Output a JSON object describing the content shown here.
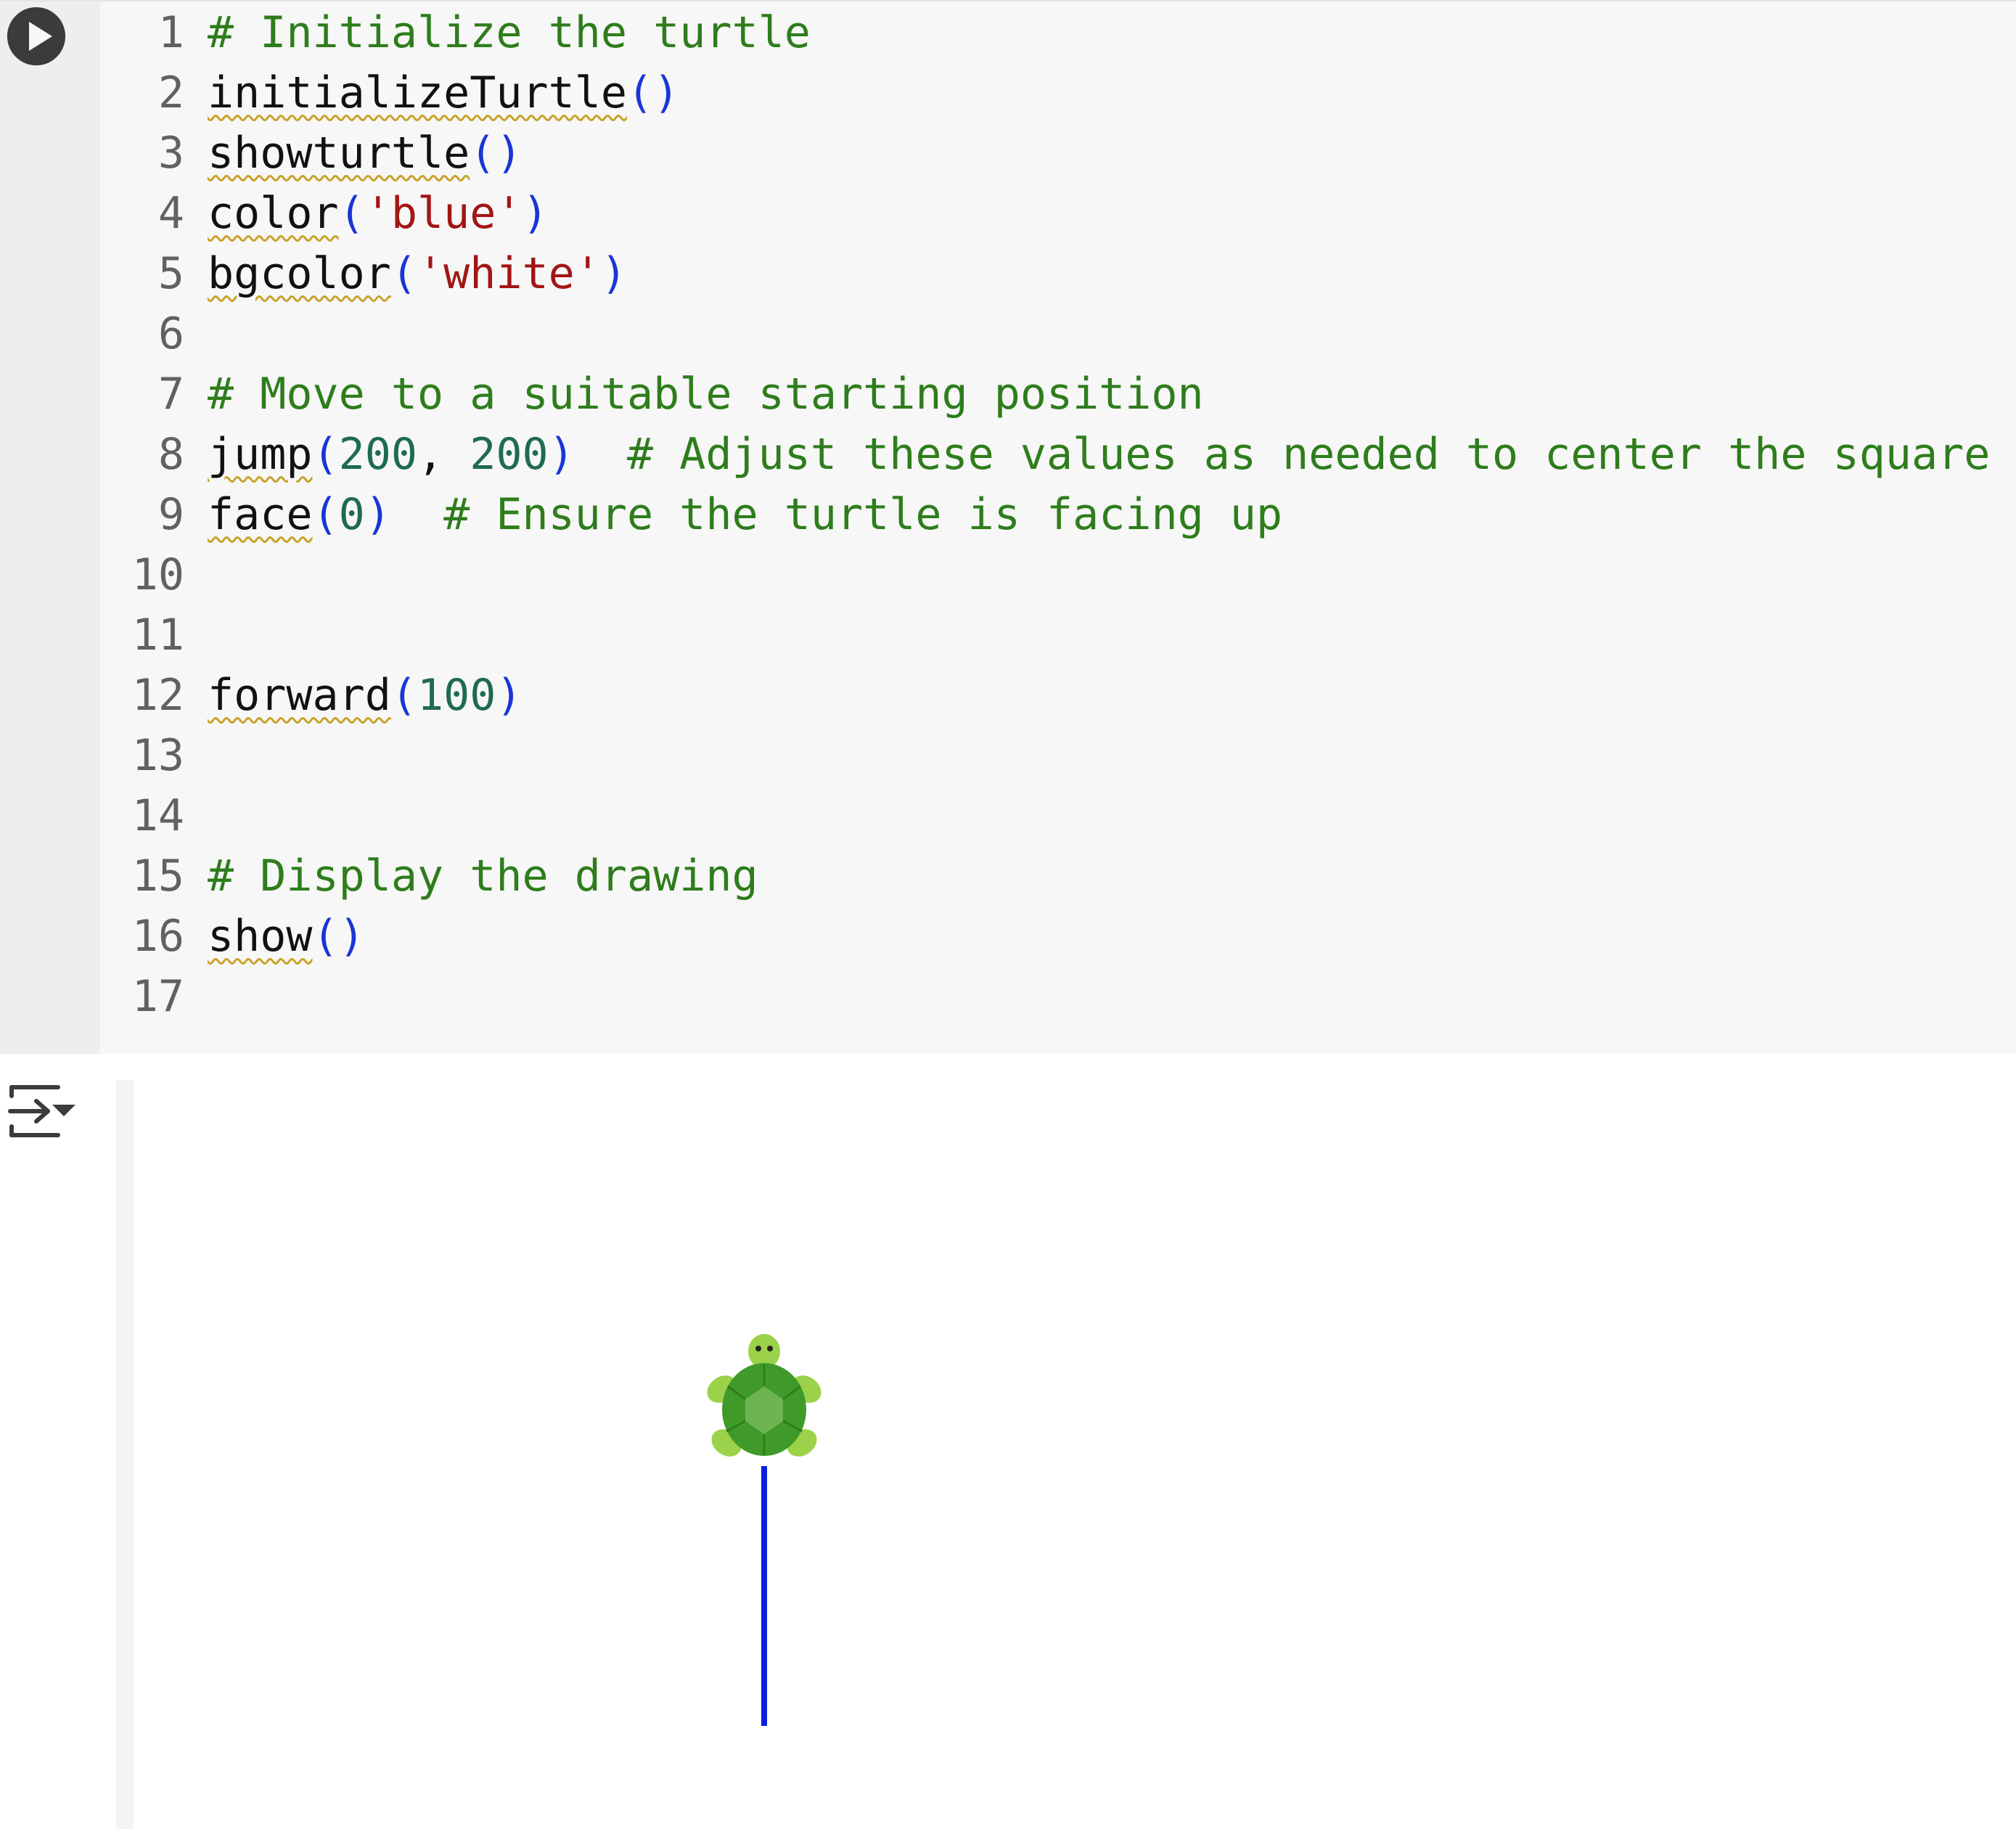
{
  "code_lines": [
    {
      "n": "1",
      "tokens": [
        {
          "t": "# Initialize the turtle",
          "k": "cmt"
        }
      ]
    },
    {
      "n": "2",
      "tokens": [
        {
          "t": "initializeTurtle",
          "k": "fn"
        },
        {
          "t": "()",
          "k": "par"
        }
      ]
    },
    {
      "n": "3",
      "tokens": [
        {
          "t": "showturtle",
          "k": "fn"
        },
        {
          "t": "()",
          "k": "par"
        }
      ]
    },
    {
      "n": "4",
      "tokens": [
        {
          "t": "color",
          "k": "fn"
        },
        {
          "t": "(",
          "k": "par"
        },
        {
          "t": "'blue'",
          "k": "str"
        },
        {
          "t": ")",
          "k": "par"
        }
      ]
    },
    {
      "n": "5",
      "tokens": [
        {
          "t": "bgcolor",
          "k": "fn"
        },
        {
          "t": "(",
          "k": "par"
        },
        {
          "t": "'white'",
          "k": "str"
        },
        {
          "t": ")",
          "k": "par"
        }
      ]
    },
    {
      "n": "6",
      "tokens": []
    },
    {
      "n": "7",
      "tokens": [
        {
          "t": "# Move to a suitable starting position",
          "k": "cmt"
        }
      ]
    },
    {
      "n": "8",
      "tokens": [
        {
          "t": "jump",
          "k": "fn"
        },
        {
          "t": "(",
          "k": "par"
        },
        {
          "t": "200",
          "k": "num"
        },
        {
          "t": ", ",
          "k": "plain"
        },
        {
          "t": "200",
          "k": "num"
        },
        {
          "t": ")",
          "k": "par"
        },
        {
          "t": "  ",
          "k": "plain"
        },
        {
          "t": "# Adjust these values as needed to center the square",
          "k": "cmt"
        }
      ]
    },
    {
      "n": "9",
      "tokens": [
        {
          "t": "face",
          "k": "fn"
        },
        {
          "t": "(",
          "k": "par"
        },
        {
          "t": "0",
          "k": "num"
        },
        {
          "t": ")",
          "k": "par"
        },
        {
          "t": "  ",
          "k": "plain"
        },
        {
          "t": "# Ensure the turtle is facing up",
          "k": "cmt"
        }
      ]
    },
    {
      "n": "10",
      "tokens": []
    },
    {
      "n": "11",
      "tokens": []
    },
    {
      "n": "12",
      "tokens": [
        {
          "t": "forward",
          "k": "fn"
        },
        {
          "t": "(",
          "k": "par"
        },
        {
          "t": "100",
          "k": "num"
        },
        {
          "t": ")",
          "k": "par"
        }
      ]
    },
    {
      "n": "13",
      "tokens": []
    },
    {
      "n": "14",
      "tokens": []
    },
    {
      "n": "15",
      "tokens": [
        {
          "t": "# Display the drawing",
          "k": "cmt"
        }
      ]
    },
    {
      "n": "16",
      "tokens": [
        {
          "t": "show",
          "k": "fn"
        },
        {
          "t": "()",
          "k": "par"
        }
      ]
    },
    {
      "n": "17",
      "tokens": []
    }
  ],
  "colors": {
    "comment": "#2e7d1c",
    "paren": "#1a35d6",
    "string": "#a31515",
    "number": "#1f6b52",
    "pen": "#0b1ee0",
    "turtle_shell": "#3f9a2a",
    "turtle_body": "#9bd24a"
  },
  "icons": {
    "run": "play-circle-icon",
    "output_toggle": "output-collapse-icon",
    "turtle": "turtle-icon"
  }
}
